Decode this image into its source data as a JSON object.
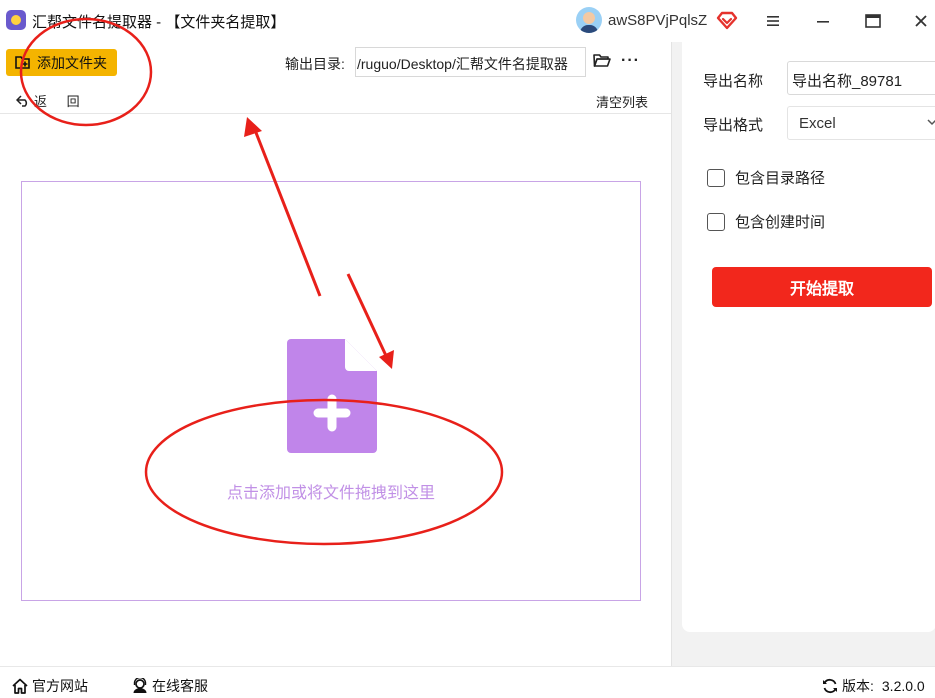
{
  "window": {
    "title": "汇帮文件名提取器 - 【文件夹名提取】",
    "username": "awS8PVjPqlsZ",
    "logo_icon": "app-logo",
    "controls": [
      "menu-icon",
      "minimize-icon",
      "maximize-icon",
      "close-icon"
    ]
  },
  "toolbar": {
    "add_folder_label": "添加文件夹",
    "back_label": "返 回",
    "output_dir_label": "输出目录:",
    "output_dir_value": "/ruguo/Desktop/汇帮文件名提取器",
    "more_label": "···",
    "clear_list_label": "清空列表"
  },
  "dropzone": {
    "text": "点击添加或将文件拖拽到这里",
    "icon": "file-add-icon",
    "accent_color": "#c190e6"
  },
  "settings": {
    "export_name_label": "导出名称",
    "export_name_value": "导出名称_89781",
    "export_format_label": "导出格式",
    "export_format_value": "Excel",
    "include_path_label": "包含目录路径",
    "include_path_checked": false,
    "include_created_label": "包含创建时间",
    "include_created_checked": false,
    "start_button_label": "开始提取",
    "start_button_color": "#f2271c"
  },
  "footer": {
    "website_label": "官方网站",
    "service_label": "在线客服",
    "version_label": "版本:",
    "version_value": "3.2.0.0"
  },
  "colors": {
    "primary_yellow": "#f4b400",
    "annotation_red": "#e8201a"
  }
}
